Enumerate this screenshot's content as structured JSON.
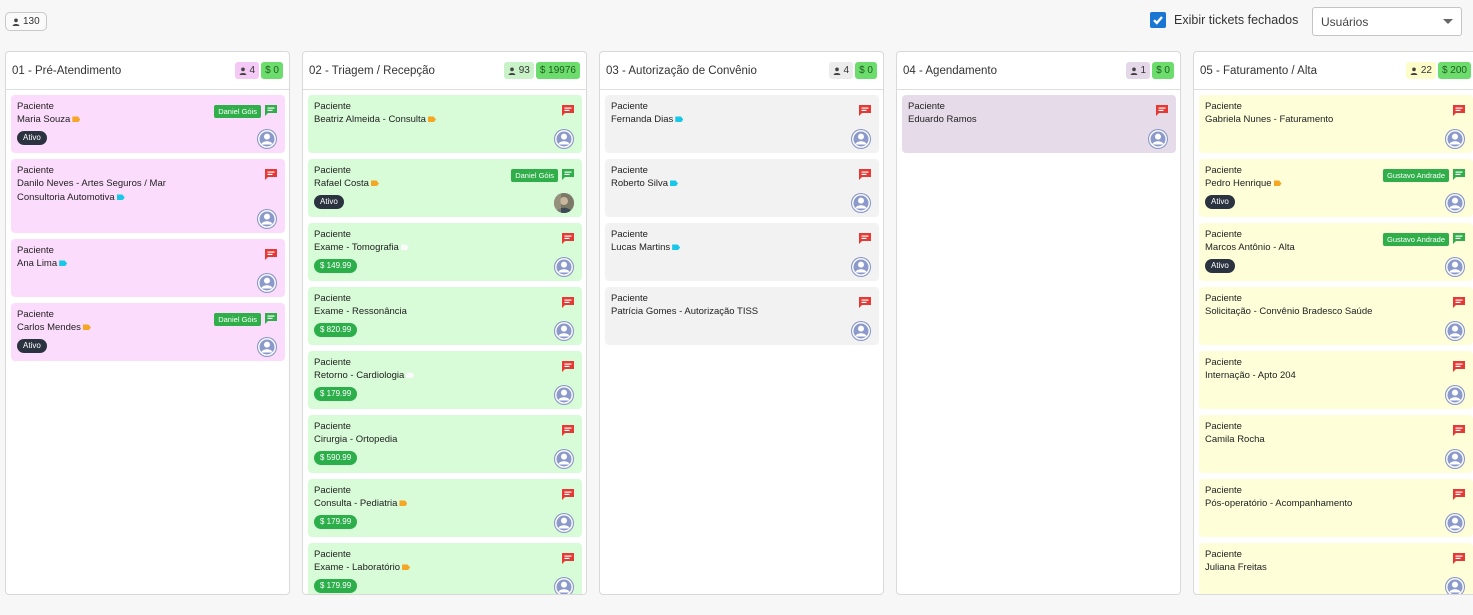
{
  "topbar": {
    "total_count": "130",
    "closed_toggle_label": "Exibir tickets fechados",
    "closed_toggle_checked": true,
    "users_select_value": "Usuários"
  },
  "colors": {
    "accent": "#1976d2",
    "chat_red": "#e53935",
    "chat_green": "#2fae4a",
    "user_tag_green": "#2fae4a",
    "status_dark": "#2c3340"
  },
  "columns": [
    {
      "title": "01 - Pré-Atendimento",
      "count": "4",
      "amount": "$ 0",
      "count_bg": "#f5c9f5",
      "cards": [
        {
          "label": "Paciente",
          "name": "Maria Souza",
          "tag": "orange",
          "user": "Daniel Góis",
          "chat": "green",
          "status": "Ativo",
          "price": null,
          "bg": "pink"
        },
        {
          "label": "Paciente",
          "name": "Danilo Neves - Artes Seguros / Mar Consultoria Automotiva",
          "tag": "cyan",
          "user": null,
          "chat": "red",
          "status": null,
          "price": null,
          "bg": "pink"
        },
        {
          "label": "Paciente",
          "name": "Ana Lima",
          "tag": "cyan",
          "user": null,
          "chat": "red",
          "status": null,
          "price": null,
          "bg": "pink"
        },
        {
          "label": "Paciente",
          "name": "Carlos Mendes",
          "tag": "orange",
          "user": "Daniel Góis",
          "chat": "green",
          "status": "Ativo",
          "price": null,
          "bg": "pink"
        }
      ]
    },
    {
      "title": "02 - Triagem / Recepção",
      "count": "93",
      "amount": "$ 19976",
      "count_bg": "#c9f2c9",
      "cards": [
        {
          "label": "Paciente",
          "name": "Beatriz Almeida - Consulta",
          "tag": "orange",
          "user": null,
          "chat": "red",
          "status": null,
          "price": null,
          "bg": "green"
        },
        {
          "label": "Paciente",
          "name": "Rafael Costa",
          "tag": "orange",
          "user": "Daniel Góis",
          "chat": "green",
          "status": "Ativo",
          "price": null,
          "bg": "green",
          "photo": true
        },
        {
          "label": "Paciente",
          "name": "Exame - Tomografia",
          "tag": "white",
          "user": null,
          "chat": "red",
          "status": null,
          "price": "$ 149.99",
          "bg": "green"
        },
        {
          "label": "Paciente",
          "name": "Exame - Ressonância",
          "tag": null,
          "user": null,
          "chat": "red",
          "status": null,
          "price": "$ 820.99",
          "bg": "green"
        },
        {
          "label": "Paciente",
          "name": "Retorno - Cardiologia",
          "tag": "white",
          "user": null,
          "chat": "red",
          "status": null,
          "price": "$ 179.99",
          "bg": "green"
        },
        {
          "label": "Paciente",
          "name": "Cirurgia - Ortopedia",
          "tag": null,
          "user": null,
          "chat": "red",
          "status": null,
          "price": "$ 590.99",
          "bg": "green"
        },
        {
          "label": "Paciente",
          "name": "Consulta - Pediatria",
          "tag": "orange",
          "user": null,
          "chat": "red",
          "status": null,
          "price": "$ 179.99",
          "bg": "green"
        },
        {
          "label": "Paciente",
          "name": "Exame - Laboratório",
          "tag": "orange",
          "user": null,
          "chat": "red",
          "status": null,
          "price": "$ 179.99",
          "bg": "green"
        }
      ]
    },
    {
      "title": "03 - Autorização de Convênio",
      "count": "4",
      "amount": "$ 0",
      "count_bg": "#ececec",
      "cards": [
        {
          "label": "Paciente",
          "name": "Fernanda Dias",
          "tag": "cyan",
          "user": null,
          "chat": "red",
          "status": null,
          "price": null,
          "bg": "gray"
        },
        {
          "label": "Paciente",
          "name": "Roberto Silva",
          "tag": "cyan",
          "user": null,
          "chat": "red",
          "status": null,
          "price": null,
          "bg": "gray"
        },
        {
          "label": "Paciente",
          "name": "Lucas Martins",
          "tag": "cyan",
          "user": null,
          "chat": "red",
          "status": null,
          "price": null,
          "bg": "gray"
        },
        {
          "label": "Paciente",
          "name": "Patrícia Gomes - Autorização TISS",
          "tag": null,
          "user": null,
          "chat": "red",
          "status": null,
          "price": null,
          "bg": "gray"
        }
      ]
    },
    {
      "title": "04 - Agendamento",
      "count": "1",
      "amount": "$ 0",
      "count_bg": "#e4d8e8",
      "cards": [
        {
          "label": "Paciente",
          "name": "Eduardo Ramos",
          "tag": null,
          "user": null,
          "chat": "red",
          "status": null,
          "price": null,
          "bg": "lilac"
        }
      ]
    },
    {
      "title": "05 - Faturamento / Alta",
      "count": "22",
      "amount": "$ 200",
      "count_bg": "#fdfdc9",
      "cards": [
        {
          "label": "Paciente",
          "name": "Gabriela Nunes - Faturamento",
          "tag": null,
          "user": null,
          "chat": "red",
          "status": null,
          "price": null,
          "bg": "yellow"
        },
        {
          "label": "Paciente",
          "name": "Pedro Henrique",
          "tag": "orange",
          "user": "Gustavo Andrade",
          "chat": "green",
          "status": "Ativo",
          "price": null,
          "bg": "yellow"
        },
        {
          "label": "Paciente",
          "name": "Marcos Antônio - Alta",
          "tag": null,
          "user": "Gustavo Andrade",
          "chat": "green",
          "status": "Ativo",
          "price": null,
          "bg": "yellow"
        },
        {
          "label": "Paciente",
          "name": "Solicitação - Convênio Bradesco Saúde",
          "tag": null,
          "user": null,
          "chat": "red",
          "status": null,
          "price": null,
          "bg": "yellow"
        },
        {
          "label": "Paciente",
          "name": "Internação - Apto 204",
          "tag": null,
          "user": null,
          "chat": "red",
          "status": null,
          "price": null,
          "bg": "yellow"
        },
        {
          "label": "Paciente",
          "name": "Camila Rocha",
          "tag": null,
          "user": null,
          "chat": "red",
          "status": null,
          "price": null,
          "bg": "yellow"
        },
        {
          "label": "Paciente",
          "name": "Pós-operatório - Acompanhamento",
          "tag": null,
          "user": null,
          "chat": "red",
          "status": null,
          "price": null,
          "bg": "yellow"
        },
        {
          "label": "Paciente",
          "name": "Juliana Freitas",
          "tag": null,
          "user": null,
          "chat": "red",
          "status": null,
          "price": null,
          "bg": "yellow"
        }
      ]
    }
  ]
}
